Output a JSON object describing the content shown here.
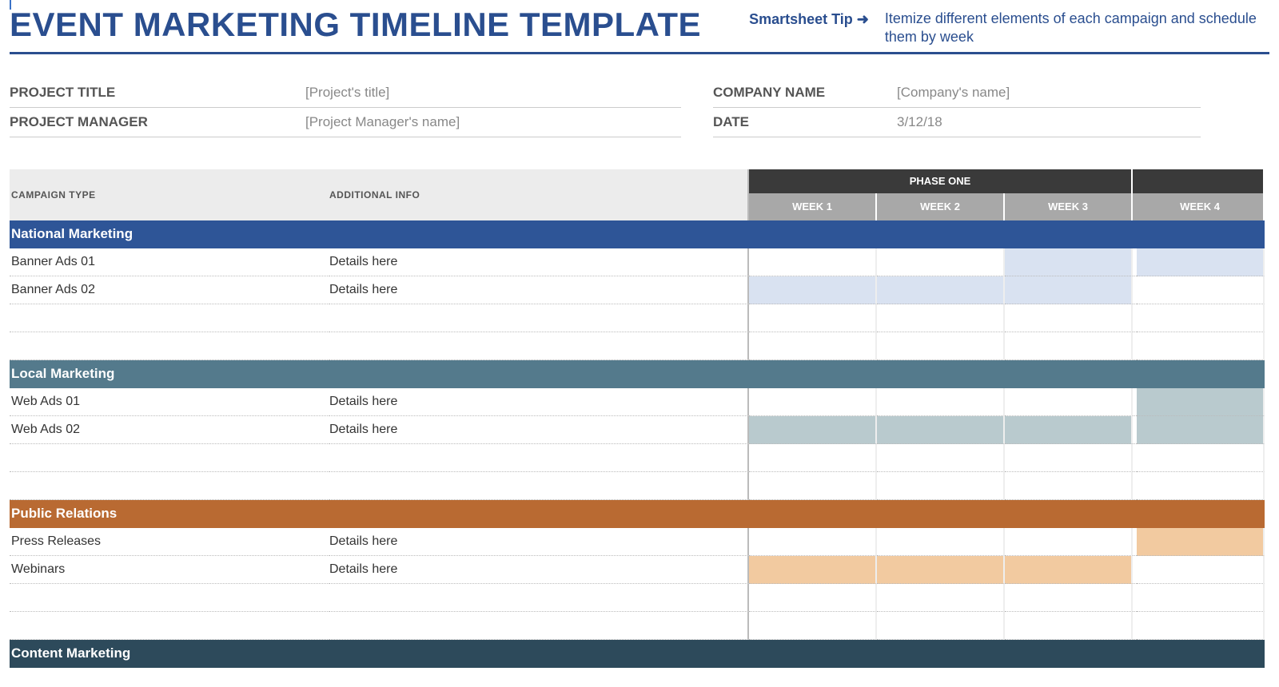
{
  "header": {
    "title": "EVENT MARKETING TIMELINE TEMPLATE",
    "tip_label": "Smartsheet Tip",
    "tip_arrow": "➜",
    "tip_desc": "Itemize different elements of each campaign and schedule them by week"
  },
  "info": {
    "project_title_label": "PROJECT TITLE",
    "project_title_value": "[Project's title]",
    "project_manager_label": "PROJECT MANAGER",
    "project_manager_value": "[Project Manager's name]",
    "company_label": "COMPANY NAME",
    "company_value": "[Company's name]",
    "date_label": "DATE",
    "date_value": "3/12/18"
  },
  "columns": {
    "campaign": "CAMPAIGN TYPE",
    "info": "ADDITIONAL INFO",
    "phase": "PHASE ONE",
    "weeks": [
      "WEEK 1",
      "WEEK 2",
      "WEEK 3",
      "WEEK 4"
    ]
  },
  "sections": [
    {
      "key": "national",
      "name": "National Marketing",
      "color_class": "sec-nat",
      "fill_class": "fill-nat",
      "rows": [
        {
          "name": "Banner Ads 01",
          "info": "Details here",
          "weeks": [
            false,
            false,
            true,
            true
          ]
        },
        {
          "name": "Banner Ads 02",
          "info": "Details here",
          "weeks": [
            true,
            true,
            true,
            false
          ]
        },
        {
          "name": "",
          "info": "",
          "weeks": [
            false,
            false,
            false,
            false
          ]
        },
        {
          "name": "",
          "info": "",
          "weeks": [
            false,
            false,
            false,
            false
          ]
        }
      ]
    },
    {
      "key": "local",
      "name": "Local Marketing",
      "color_class": "sec-local",
      "fill_class": "fill-loc",
      "rows": [
        {
          "name": "Web Ads 01",
          "info": "Details here",
          "weeks": [
            false,
            false,
            false,
            true
          ]
        },
        {
          "name": "Web Ads 02",
          "info": "Details here",
          "weeks": [
            true,
            true,
            true,
            true
          ]
        },
        {
          "name": "",
          "info": "",
          "weeks": [
            false,
            false,
            false,
            false
          ]
        },
        {
          "name": "",
          "info": "",
          "weeks": [
            false,
            false,
            false,
            false
          ]
        }
      ]
    },
    {
      "key": "pr",
      "name": "Public Relations",
      "color_class": "sec-pr",
      "fill_class": "fill-pr",
      "rows": [
        {
          "name": "Press Releases",
          "info": "Details here",
          "weeks": [
            false,
            false,
            false,
            true
          ]
        },
        {
          "name": "Webinars",
          "info": "Details here",
          "weeks": [
            true,
            true,
            true,
            false
          ]
        },
        {
          "name": "",
          "info": "",
          "weeks": [
            false,
            false,
            false,
            false
          ]
        },
        {
          "name": "",
          "info": "",
          "weeks": [
            false,
            false,
            false,
            false
          ]
        }
      ]
    },
    {
      "key": "content",
      "name": "Content Marketing",
      "color_class": "sec-cm",
      "fill_class": "",
      "rows": []
    }
  ]
}
